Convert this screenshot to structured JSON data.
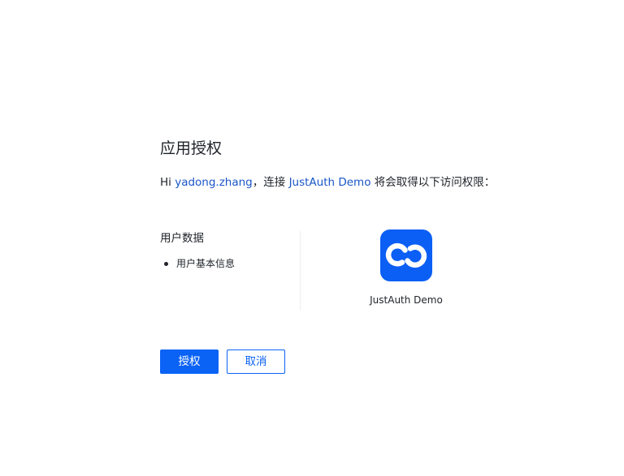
{
  "header": {
    "title": "应用授权"
  },
  "intro": {
    "greeting": "Hi ",
    "username": "yadong.zhang",
    "connector": "，连接 ",
    "app_name": "JustAuth Demo",
    "suffix": " 将会取得以下访问权限："
  },
  "permissions": {
    "heading": "用户数据",
    "items": [
      {
        "label": "用户基本信息"
      }
    ]
  },
  "app": {
    "name": "JustAuth Demo",
    "logo_icon": "chain-link-icon",
    "logo_color": "#0B5FF5"
  },
  "actions": {
    "authorize_label": "授权",
    "cancel_label": "取消"
  },
  "colors": {
    "accent": "#0B63F6",
    "link": "#1A56C8",
    "text": "#1F2329"
  }
}
